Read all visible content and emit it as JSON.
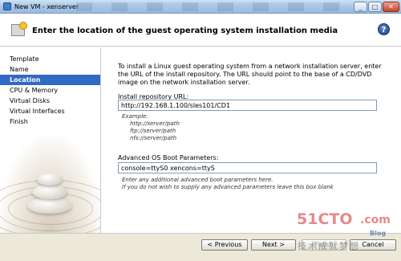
{
  "window": {
    "title": "New VM - xenserver"
  },
  "header": {
    "heading": "Enter the location of the guest operating system installation media",
    "help": "?"
  },
  "sidebar": {
    "items": [
      {
        "label": "Template"
      },
      {
        "label": "Name"
      },
      {
        "label": "Location"
      },
      {
        "label": "CPU & Memory"
      },
      {
        "label": "Virtual Disks"
      },
      {
        "label": "Virtual Interfaces"
      },
      {
        "label": "Finish"
      }
    ],
    "active": "Location"
  },
  "main": {
    "intro": "To install a Linux guest operating system from a network installation server, enter the URL of the install repository. The URL should point to the base of a CD/DVD image on the network installation server.",
    "repo_label": "Install repository URL:",
    "repo_value": "http://192.168.1.100/sles101/CD1",
    "example_title": "Example:",
    "examples": [
      "http://server/path",
      "ftp://server/path",
      "nfs://server/path"
    ],
    "boot_label": "Advanced OS Boot Parameters:",
    "boot_value": "console=ttyS0 xencons=ttyS",
    "boot_hint_1": "Enter any additional advanced boot parameters here.",
    "boot_hint_2": "If you do not wish to supply any advanced parameters leave this box blank"
  },
  "footer": {
    "previous": "< Previous",
    "next": "Next >",
    "finish": "Finish",
    "cancel": "Cancel"
  },
  "watermark": {
    "main": "51CTO",
    "com": ".com",
    "sub": "技术成就梦想",
    "blog": "Blog"
  }
}
